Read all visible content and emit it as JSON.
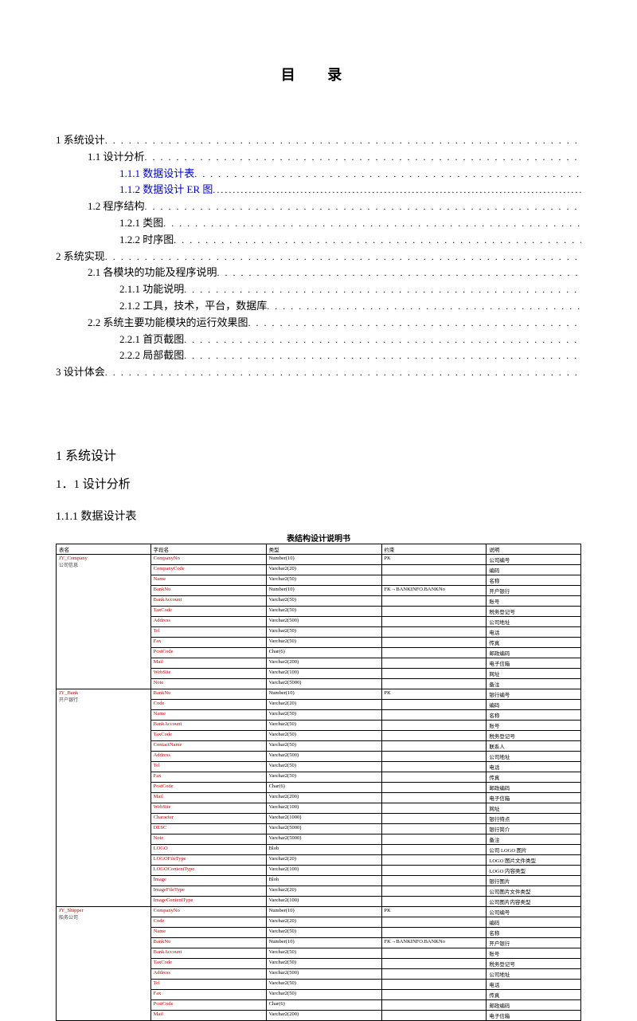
{
  "title": "目 录",
  "toc": [
    {
      "lvl": 1,
      "label": "1 系统设计",
      "link": false
    },
    {
      "lvl": 2,
      "label": "1.1 设计分析",
      "link": false
    },
    {
      "lvl": 3,
      "label": "1.1.1  数据设计表",
      "link": true
    },
    {
      "lvl": 3,
      "label": "1.1.2  数据设计 ER 图",
      "link": true,
      "solidline": true
    },
    {
      "lvl": 2,
      "label": "1.2 程序结构",
      "link": false
    },
    {
      "lvl": 3,
      "label": "1.2.1  类图",
      "link": false
    },
    {
      "lvl": 3,
      "label": "1.2.2  时序图",
      "link": false
    },
    {
      "lvl": 1,
      "label": "2  系统实现",
      "link": false
    },
    {
      "lvl": 2,
      "label": "2.1 各模块的功能及程序说明",
      "link": false
    },
    {
      "lvl": 3,
      "label": "2.1.1  功能说明",
      "link": false
    },
    {
      "lvl": 3,
      "label": "2.1.2  工具，技术，平台，数据库",
      "link": false
    },
    {
      "lvl": 2,
      "label": "2.2 系统主要功能模块的运行效果图",
      "link": false
    },
    {
      "lvl": 3,
      "label": "2.2.1  首页截图",
      "link": false
    },
    {
      "lvl": 3,
      "label": "2.2.2  局部截图",
      "link": false
    },
    {
      "lvl": 1,
      "label": "3  设计体会",
      "link": false
    }
  ],
  "section1": "1 系统设计",
  "section11": "1．1 设计分析",
  "section111": "1.1.1 数据设计表",
  "tableCaption": "表结构设计说明书",
  "headers": [
    "表名",
    "字段名",
    "类型",
    "约束",
    "说明"
  ],
  "rows": [
    {
      "name": "JY_Company",
      "nameZh": "公司信息",
      "fields": [
        [
          "CompanyNo",
          "Number(10)",
          "PK",
          "公司编号"
        ],
        [
          "CompanyCode",
          "Varchar2(20)",
          "",
          "编码"
        ],
        [
          "Name",
          "Varchar2(50)",
          "",
          "名称"
        ],
        [
          "BankNo",
          "Number(10)",
          "FK→BANKINFO.BANKNo",
          "开户银行"
        ],
        [
          "BankAccount",
          "Varchar2(50)",
          "",
          "账号"
        ],
        [
          "TaxCode",
          "Varchar2(50)",
          "",
          "税务登记号"
        ],
        [
          "Address",
          "Varchar2(500)",
          "",
          "公司地址"
        ],
        [
          "Tel",
          "Varchar2(50)",
          "",
          "电话"
        ],
        [
          "Fax",
          "Varchar2(50)",
          "",
          "传真"
        ],
        [
          "PostCode",
          "Char(6)",
          "",
          "邮政编码"
        ],
        [
          "Mail",
          "Varchar2(200)",
          "",
          "电子信箱"
        ],
        [
          "WebSite",
          "Varchar2(100)",
          "",
          "网址"
        ],
        [
          "Note",
          "Varchar2(5000)",
          "",
          "备注"
        ]
      ]
    },
    {
      "name": "JY_Bank",
      "nameZh": "开户银行",
      "fields": [
        [
          "BankNo",
          "Number(10)",
          "PK",
          "银行编号"
        ],
        [
          "Code",
          "Varchar2(20)",
          "",
          "编码"
        ],
        [
          "Name",
          "Varchar2(50)",
          "",
          "名称"
        ],
        [
          "BankAccount",
          "Varchar2(50)",
          "",
          "账号"
        ],
        [
          "TaxCode",
          "Varchar2(50)",
          "",
          "税务登记号"
        ],
        [
          "ContactName",
          "Varchar2(50)",
          "",
          "联系人"
        ],
        [
          "Address",
          "Varchar2(500)",
          "",
          "公司地址"
        ],
        [
          "Tel",
          "Varchar2(50)",
          "",
          "电话"
        ],
        [
          "Fax",
          "Varchar2(50)",
          "",
          "传真"
        ],
        [
          "PostCode",
          "Char(6)",
          "",
          "邮政编码"
        ],
        [
          "Mail",
          "Varchar2(200)",
          "",
          "电子信箱"
        ],
        [
          "WebSite",
          "Varchar2(100)",
          "",
          "网址"
        ],
        [
          "Character",
          "Varchar2(1000)",
          "",
          "银行特点"
        ],
        [
          "DESC",
          "Varchar2(5000)",
          "",
          "银行简介"
        ],
        [
          "Note",
          "Varchar2(5000)",
          "",
          "备注"
        ],
        [
          "LOGO",
          "Blob",
          "",
          "公司 LOGO 图片"
        ],
        [
          "LOGOFileType",
          "Varchar2(20)",
          "",
          "LOGO 图片文件类型"
        ],
        [
          "LOGOContentType",
          "Varchar2(100)",
          "",
          "LOGO 内容类型"
        ],
        [
          "Image",
          "Blob",
          "",
          "银行图片"
        ],
        [
          "ImageFileType",
          "Varchar2(20)",
          "",
          "公司图片文件类型"
        ],
        [
          "ImageContentType",
          "Varchar2(100)",
          "",
          "公司图片内容类型"
        ]
      ]
    },
    {
      "name": "JY_Shipper",
      "nameZh": "船务公司",
      "fields": [
        [
          "CompanyNo",
          "Number(10)",
          "PK",
          "公司编号"
        ],
        [
          "Code",
          "Varchar2(20)",
          "",
          "编码"
        ],
        [
          "Name",
          "Varchar2(50)",
          "",
          "名称"
        ],
        [
          "BankNo",
          "Number(10)",
          "FK→BANKINFO.BANKNo",
          "开户银行"
        ],
        [
          "BankAccount",
          "Varchar2(50)",
          "",
          "账号"
        ],
        [
          "TaxCode",
          "Varchar2(50)",
          "",
          "税务登记号"
        ],
        [
          "Address",
          "Varchar2(500)",
          "",
          "公司地址"
        ],
        [
          "Tel",
          "Varchar2(50)",
          "",
          "电话"
        ],
        [
          "Fax",
          "Varchar2(50)",
          "",
          "传真"
        ],
        [
          "PostCode",
          "Char(6)",
          "",
          "邮政编码"
        ],
        [
          "Mail",
          "Varchar2(200)",
          "",
          "电子信箱"
        ]
      ]
    }
  ]
}
